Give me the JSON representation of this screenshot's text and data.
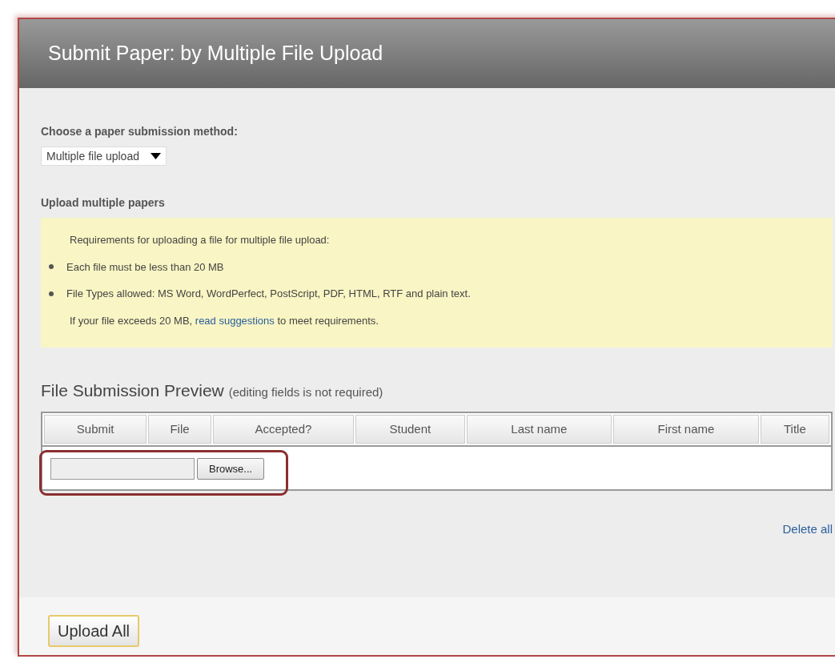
{
  "window": {
    "title": "Submit Paper: by Multiple File Upload"
  },
  "method": {
    "label": "Choose a paper submission method:",
    "value": "Multiple file upload"
  },
  "section_title": "Upload multiple papers",
  "requirements": {
    "intro": "Requirements for uploading a file for multiple file upload:",
    "items": [
      "Each file must be less than 20 MB",
      "File Types allowed: MS Word, WordPerfect, PostScript, PDF, HTML, RTF and plain text."
    ],
    "note": {
      "before": "If your file exceeds 20 MB, ",
      "link": "read suggestions",
      "after": " to meet requirements."
    }
  },
  "preview": {
    "title": "File Submission Preview",
    "hint": "(editing fields is not required)",
    "columns": [
      "Submit",
      "File",
      "Accepted?",
      "Student",
      "Last name",
      "First name",
      "Title"
    ],
    "file_row": {
      "browse_label": "Browse...",
      "highlighted": true
    }
  },
  "delete_all": "Delete all",
  "upload_button": "Upload All"
}
